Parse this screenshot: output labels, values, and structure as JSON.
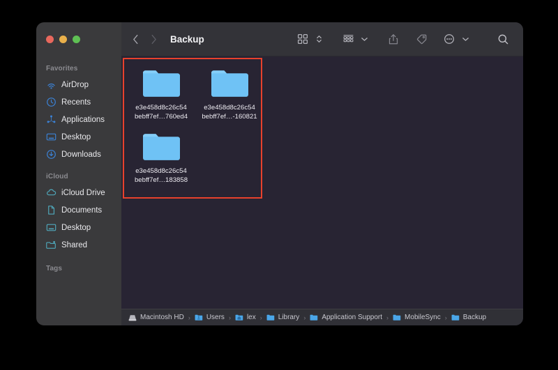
{
  "window": {
    "title": "Backup",
    "traffic_lights": [
      {
        "name": "close",
        "color": "#e8685d"
      },
      {
        "name": "minimize",
        "color": "#e9b04b"
      },
      {
        "name": "maximize",
        "color": "#5fc054"
      }
    ]
  },
  "toolbar": {
    "back_icon": "chevron-left-icon",
    "forward_icon": "chevron-right-icon",
    "view_icon": "grid-view-icon",
    "view_stepper_icon": "up-down-chevron-icon",
    "group_icon": "group-by-icon",
    "group_chevron_icon": "chevron-down-icon",
    "share_icon": "share-icon",
    "tag_icon": "tag-icon",
    "more_icon": "ellipsis-circle-icon",
    "more_chevron_icon": "chevron-down-icon",
    "search_icon": "search-icon"
  },
  "sidebar": {
    "sections": [
      {
        "title": "Favorites",
        "icon_color": "#3b82d6",
        "items": [
          {
            "label": "AirDrop",
            "icon": "airdrop-icon"
          },
          {
            "label": "Recents",
            "icon": "clock-icon"
          },
          {
            "label": "Applications",
            "icon": "applications-icon"
          },
          {
            "label": "Desktop",
            "icon": "desktop-icon"
          },
          {
            "label": "Downloads",
            "icon": "downloads-icon"
          }
        ]
      },
      {
        "title": "iCloud",
        "icon_color": "#4fa8bb",
        "items": [
          {
            "label": "iCloud Drive",
            "icon": "cloud-icon"
          },
          {
            "label": "Documents",
            "icon": "document-icon"
          },
          {
            "label": "Desktop",
            "icon": "desktop-icon"
          },
          {
            "label": "Shared",
            "icon": "shared-folder-icon"
          }
        ]
      },
      {
        "title": "Tags",
        "icon_color": "#3b82d6",
        "items": []
      }
    ]
  },
  "content": {
    "selection_color": "#e8412c",
    "folder_color": "#6fc2f5",
    "files": [
      {
        "name_line1": "e3e458d8c26c54",
        "name_line2": "bebff7ef…760ed4",
        "icon": "folder-icon"
      },
      {
        "name_line1": "e3e458d8c26c54",
        "name_line2": "bebff7ef…-160821",
        "icon": "folder-icon"
      },
      {
        "name_line1": "e3e458d8c26c54",
        "name_line2": "bebff7ef…183858",
        "icon": "folder-icon"
      }
    ]
  },
  "path_bar": {
    "crumbs": [
      {
        "label": "Macintosh HD",
        "icon": "hard-drive-icon"
      },
      {
        "label": "Users",
        "icon": "users-folder-icon"
      },
      {
        "label": "lex",
        "icon": "home-folder-icon"
      },
      {
        "label": "Library",
        "icon": "folder-icon"
      },
      {
        "label": "Application Support",
        "icon": "folder-icon"
      },
      {
        "label": "MobileSync",
        "icon": "folder-icon"
      },
      {
        "label": "Backup",
        "icon": "folder-icon"
      }
    ],
    "separator": "›"
  }
}
